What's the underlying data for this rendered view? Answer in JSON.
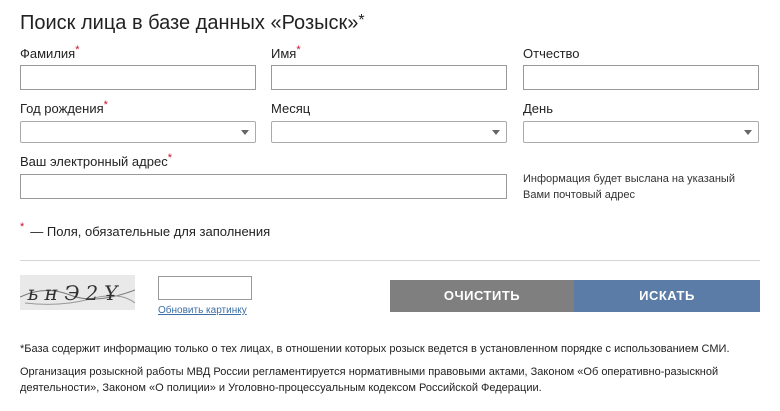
{
  "title": "Поиск лица в базе данных «Розыск»",
  "title_star": "*",
  "required_mark": "*",
  "fields": {
    "surname": {
      "label": "Фамилия",
      "value": ""
    },
    "name": {
      "label": "Имя",
      "value": ""
    },
    "patronymic": {
      "label": "Отчество",
      "value": ""
    },
    "birth_year": {
      "label": "Год рождения",
      "value": ""
    },
    "month": {
      "label": "Месяц",
      "value": ""
    },
    "day": {
      "label": "День",
      "value": ""
    },
    "email": {
      "label": "Ваш электронный адрес",
      "value": ""
    }
  },
  "email_hint": "Информация будет выслана на указаный Вами почтовый адрес",
  "required_note": "— Поля, обязательные для заполнения",
  "captcha": {
    "text": "ьнЭ2Ұ",
    "input_value": "",
    "refresh_label": "Обновить картинку"
  },
  "buttons": {
    "clear_label": "ОЧИСТИТЬ",
    "search_label": "ИСКАТЬ"
  },
  "colors": {
    "required": "#c8102e",
    "clear_button": "#7f7f7f",
    "search_button": "#5a7ca6",
    "link": "#3b6ea5"
  },
  "footnote_1": "*База содержит информацию только о тех лицах, в отношении которых розыск ведется в установленном порядке с использованием СМИ.",
  "footnote_2": "Организация розыскной работы МВД России регламентируется нормативными правовыми актами, Законом «Об оперативно-разыскной деятельности», Законом «О полиции» и Уголовно-процессуальным кодексом Российской Федерации."
}
